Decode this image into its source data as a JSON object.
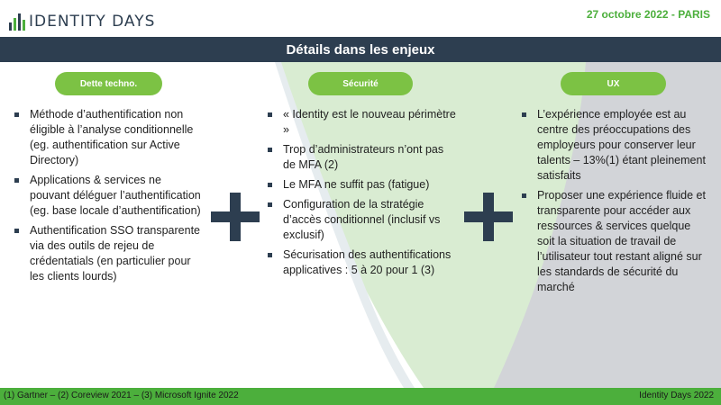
{
  "header": {
    "logo_text": "IDENTITY DAYS",
    "date": "27 octobre 2022  - PARIS"
  },
  "title": "Détails dans les enjeux",
  "columns": [
    {
      "label": "Dette techno.",
      "items": [
        "Méthode d’authentification non éligible à l’analyse conditionnelle (eg. authentification sur Active Directory)",
        "Applications & services ne pouvant déléguer l’authentification (eg. base locale d’authentification)",
        "Authentification SSO transparente via des outils de rejeu de crédentatials (en particulier pour les clients lourds)"
      ]
    },
    {
      "label": "Sécurité",
      "items": [
        "« Identity est le nouveau périmètre »",
        "Trop d’administrateurs n’ont pas de MFA (2)",
        "Le MFA ne suffit pas (fatigue)",
        "Configuration de la stratégie d’accès conditionnel (inclusif vs exclusif)",
        "Sécurisation des authentifications applicatives : 5 à 20 pour 1 (3)"
      ]
    },
    {
      "label": "UX",
      "items": [
        "L’expérience employée est au centre des préoccupations des employeurs pour conserver leur talents – 13%(1)  étant pleinement satisfaits",
        "Proposer une expérience fluide et transparente pour accéder aux ressources & services quelque soit la situation de travail de l’utilisateur tout restant aligné sur les standards de sécurité du marché"
      ]
    }
  ],
  "footer": {
    "sources": "(1) Gartner – (2) Coreview 2021 – (3) Microsoft Ignite 2022",
    "event": "Identity Days 2022"
  },
  "colors": {
    "navy": "#2d3e50",
    "green": "#4caf3c",
    "pill_green": "#7cc244",
    "light_green": "#d9ecd2",
    "light_gray": "#d2d4d8"
  }
}
